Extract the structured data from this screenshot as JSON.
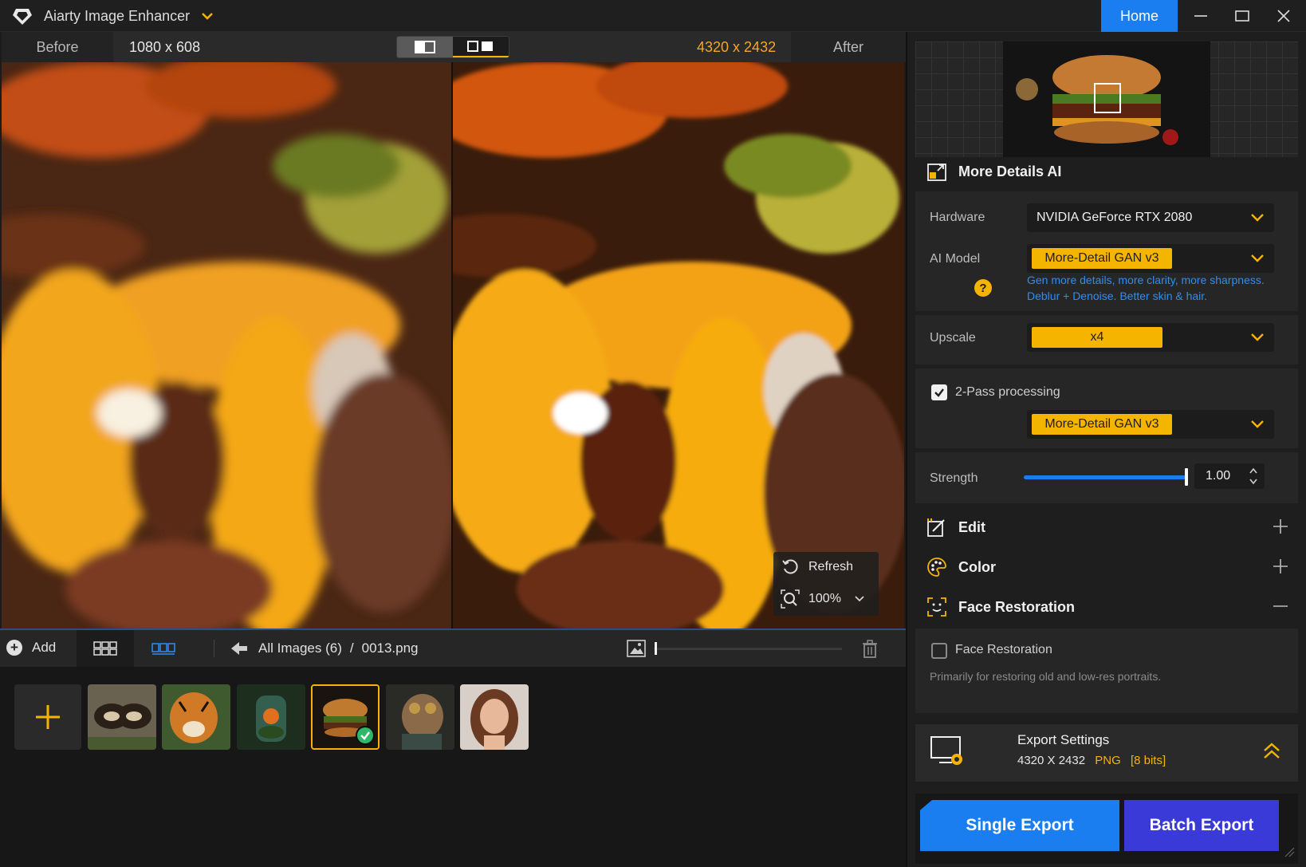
{
  "app": {
    "title": "Aiarty Image Enhancer",
    "home_label": "Home"
  },
  "compare": {
    "before_label": "Before",
    "before_resolution": "1080 x 608",
    "after_resolution": "4320 x 2432",
    "after_label": "After"
  },
  "overlay": {
    "refresh_label": "Refresh",
    "zoom_value": "100%"
  },
  "thumb_toolbar": {
    "add_label": "Add",
    "breadcrumb_root": "All Images (6)",
    "breadcrumb_separator": "/",
    "breadcrumb_file": "0013.png"
  },
  "thumbnails": [
    {
      "name": "butterfly",
      "selected": false
    },
    {
      "name": "tiger",
      "selected": false
    },
    {
      "name": "jar-garden",
      "selected": false
    },
    {
      "name": "burger",
      "selected": true
    },
    {
      "name": "steampunk-dog",
      "selected": false
    },
    {
      "name": "portrait",
      "selected": false
    }
  ],
  "panel": {
    "section_title": "More Details AI",
    "hardware_label": "Hardware",
    "hardware_value": "NVIDIA GeForce RTX 2080",
    "ai_model_label": "AI Model",
    "ai_model_value": "More-Detail GAN  v3",
    "ai_model_help_line1": "Gen more details, more clarity, more sharpness.",
    "ai_model_help_line2": "Deblur + Denoise. Better skin & hair.",
    "upscale_label": "Upscale",
    "upscale_value": "x4",
    "two_pass_label": "2-Pass processing",
    "two_pass_checked": true,
    "two_pass_model_value": "More-Detail GAN  v3",
    "strength_label": "Strength",
    "strength_value": "1.00",
    "edit_label": "Edit",
    "color_label": "Color",
    "face_restoration_label": "Face Restoration",
    "face_restoration_checkbox_label": "Face Restoration",
    "face_restoration_checked": false,
    "face_restoration_desc": "Primarily for restoring old and low-res portraits."
  },
  "export": {
    "settings_title": "Export Settings",
    "settings_resolution": "4320 X 2432",
    "settings_format": "PNG",
    "settings_bits": "[8 bits]",
    "single_export_label": "Single Export",
    "batch_export_label": "Batch Export"
  },
  "colors": {
    "accent_blue": "#1a7ef0",
    "accent_yellow": "#f5b400",
    "batch_purple": "#3a3ad8"
  }
}
